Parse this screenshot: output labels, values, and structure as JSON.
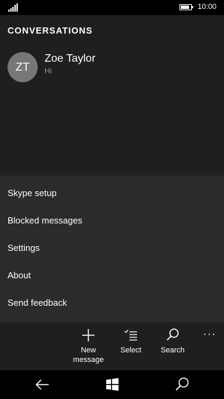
{
  "status_bar": {
    "time": "10:00",
    "battery_level": 0.85
  },
  "header": {
    "title": "CONVERSATIONS"
  },
  "conversations": [
    {
      "initials": "ZT",
      "name": "Zoe Taylor",
      "preview": "Hi"
    }
  ],
  "menu": {
    "items": [
      {
        "label": "Skype setup"
      },
      {
        "label": "Blocked messages"
      },
      {
        "label": "Settings"
      },
      {
        "label": "About"
      },
      {
        "label": "Send feedback"
      }
    ]
  },
  "app_bar": {
    "new_message_line1": "New",
    "new_message_line2": "message",
    "select": "Select",
    "search": "Search",
    "more": "···"
  },
  "icons": {
    "signal": "signal-icon",
    "battery": "battery-icon",
    "new_message": "plus-icon",
    "select": "checklist-icon",
    "search": "search-icon",
    "back": "back-arrow-icon",
    "start": "windows-logo-icon",
    "cortana": "search-icon"
  },
  "colors": {
    "background": "#1f1f1f",
    "menu_background": "#2b2b2b",
    "avatar": "#777777",
    "system_bar": "#000000"
  }
}
